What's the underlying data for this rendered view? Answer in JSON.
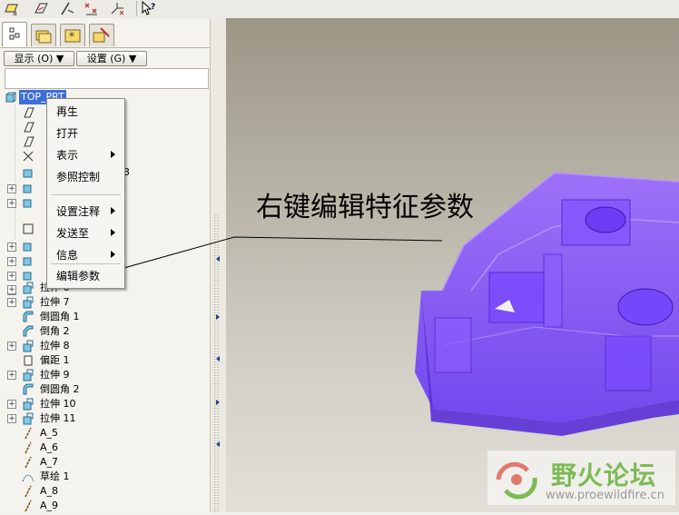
{
  "toolbar": {
    "icons": [
      "datum-plane-icon",
      "datum-axis-icon",
      "datum-curve-icon",
      "datum-point-icon",
      "coordinate-system-icon",
      "whats-this-help-icon"
    ]
  },
  "navigator": {
    "tabs": [
      "model-tree-tab",
      "folder-browser-tab",
      "favorites-tab",
      "connections-tab"
    ],
    "show_button": "显示 (O) ▼",
    "settings_button": "设置 (G) ▼"
  },
  "tree": {
    "root": "TOP_PRT",
    "partially_hidden_suffix": "3",
    "items": [
      {
        "label": "拉伸 6",
        "icon": "extrude-icon",
        "expandable": true
      },
      {
        "label": "拉伸 7",
        "icon": "extrude-icon",
        "expandable": true
      },
      {
        "label": "倒圆角 1",
        "icon": "round-icon",
        "expandable": false
      },
      {
        "label": "倒角 2",
        "icon": "chamfer-icon",
        "expandable": false
      },
      {
        "label": "拉伸 8",
        "icon": "extrude-icon",
        "expandable": true
      },
      {
        "label": "偏距 1",
        "icon": "offset-icon",
        "expandable": false
      },
      {
        "label": "拉伸 9",
        "icon": "extrude-icon",
        "expandable": true
      },
      {
        "label": "倒圆角 2",
        "icon": "round-icon",
        "expandable": false
      },
      {
        "label": "拉伸 10",
        "icon": "extrude-icon",
        "expandable": true
      },
      {
        "label": "拉伸 11",
        "icon": "extrude-icon",
        "expandable": true
      },
      {
        "label": "A_5",
        "icon": "datum-axis-icon",
        "expandable": false
      },
      {
        "label": "A_6",
        "icon": "datum-axis-icon",
        "expandable": false
      },
      {
        "label": "A_7",
        "icon": "datum-axis-icon",
        "expandable": false
      },
      {
        "label": "草绘 1",
        "icon": "sketch-icon",
        "expandable": false
      },
      {
        "label": "A_8",
        "icon": "datum-axis-icon",
        "expandable": false
      },
      {
        "label": "A_9",
        "icon": "datum-axis-icon",
        "expandable": false
      }
    ]
  },
  "context_menu": {
    "items": [
      {
        "label": "再生",
        "submenu": false
      },
      {
        "label": "打开",
        "submenu": false
      },
      {
        "label": "表示",
        "submenu": true
      },
      {
        "label": "参照控制",
        "submenu": false
      },
      {
        "label": "设置注释",
        "submenu": true
      },
      {
        "label": "发送至",
        "submenu": true
      },
      {
        "label": "信息",
        "submenu": true
      },
      {
        "label": "编辑参数",
        "submenu": false
      }
    ]
  },
  "annotation": {
    "text": "右键编辑特征参数"
  },
  "watermark": {
    "title": "野火论坛",
    "url": "www.proewildfire.cn"
  },
  "colors": {
    "model": "#7b4dfa",
    "selection": "#3d6ed8",
    "watermark_green": "#7dba54"
  }
}
